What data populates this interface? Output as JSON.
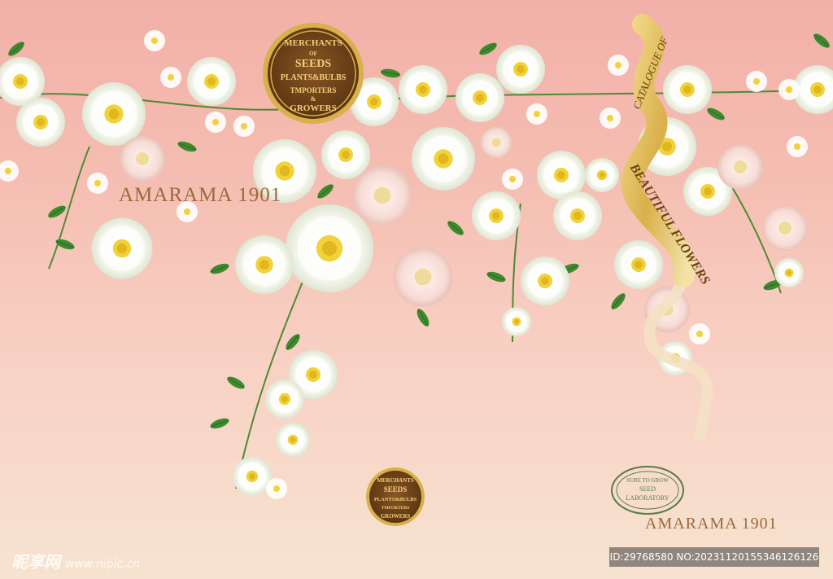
{
  "colors": {
    "background_top": "#f2b0a8",
    "background_bottom": "#f7e3d0",
    "seal_gold": "#c8a24a",
    "seal_brown": "#7a4a1e",
    "brand_text": "#9a6a3a",
    "ribbon_gold": "#e6c35a"
  },
  "seal": {
    "line1": "MERCHANTS",
    "line2": "OF",
    "line3": "SEEDS",
    "line4": "PLANTS&BULBS",
    "line5": "TMPORTERS",
    "line6": "&",
    "line7": "GROWERS"
  },
  "brand": {
    "top": "AMARAMA 1901",
    "bottom": "AMARAMA 1901"
  },
  "ribbon": {
    "line1": "CATALOGUE OF",
    "line2": "BEAUTIFUL FLOWERS"
  },
  "stamp": {
    "line1": "SURE TO GROW",
    "line2": "SEED",
    "line3": "LABORATORY"
  },
  "watermark": {
    "site_name": "昵享网",
    "site_url": "www.nipic.cn",
    "id_text": "ID:29768580 NO:20231120155346126126"
  }
}
